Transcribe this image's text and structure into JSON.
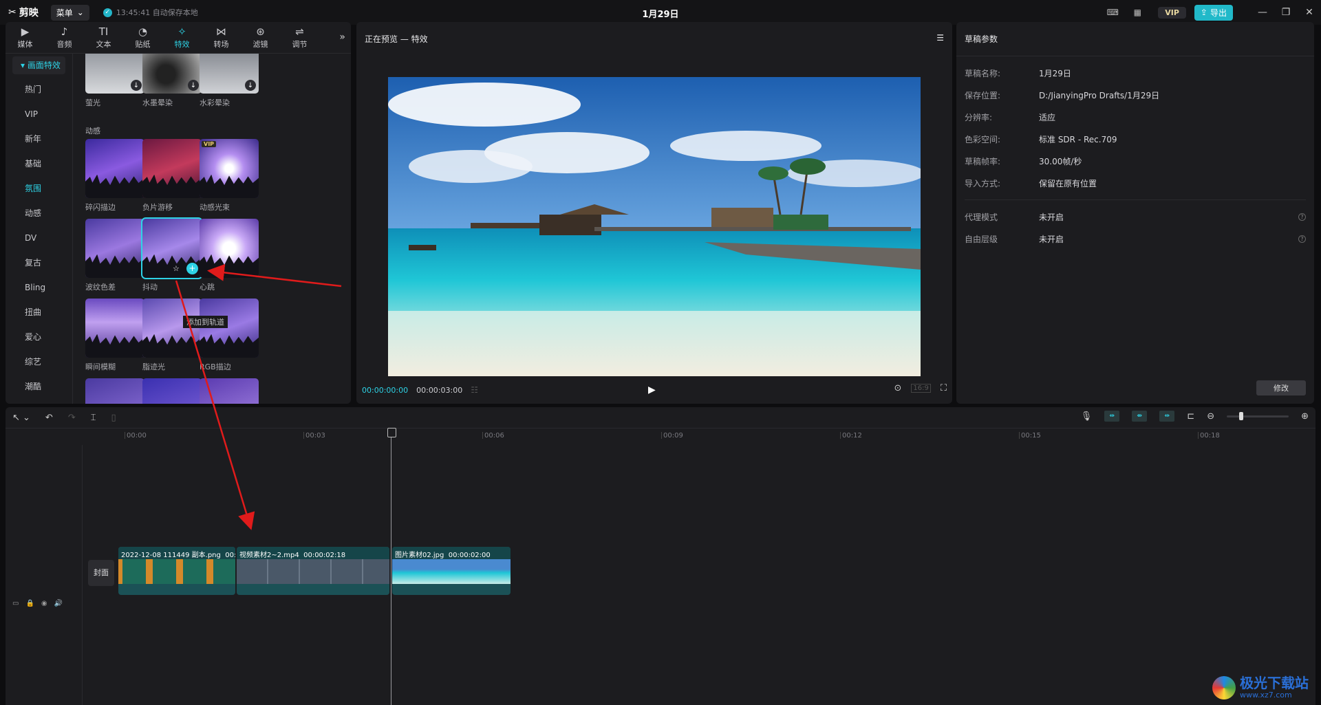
{
  "app": {
    "name": "剪映",
    "menu": "菜单",
    "autosave": "13:45:41 自动保存本地",
    "doc_title": "1月29日",
    "vip": "VIP",
    "export": "导出"
  },
  "tabs": [
    {
      "label": "媒体",
      "icon": "▶"
    },
    {
      "label": "音频",
      "icon": "♪"
    },
    {
      "label": "文本",
      "icon": "TI"
    },
    {
      "label": "贴纸",
      "icon": "◔"
    },
    {
      "label": "特效",
      "icon": "✧"
    },
    {
      "label": "转场",
      "icon": "⋈"
    },
    {
      "label": "滤镜",
      "icon": "⊛"
    },
    {
      "label": "调节",
      "icon": "⇌"
    }
  ],
  "sidebar": {
    "header": "画面特效",
    "items": [
      "热门",
      "VIP",
      "新年",
      "基础",
      "氛围",
      "动感",
      "DV",
      "复古",
      "Bling",
      "扭曲",
      "爱心",
      "综艺",
      "潮酷"
    ],
    "active": "氛围"
  },
  "effects": {
    "row0": [
      "萤光",
      "水墨晕染",
      "水彩晕染"
    ],
    "section": "动感",
    "row1": [
      "碎闪描边",
      "负片游移",
      "动感光束"
    ],
    "row2": [
      "波纹色差",
      "抖动",
      "心跳"
    ],
    "row3": [
      "瞬间模糊",
      "脂迹光",
      "RGB描边"
    ],
    "vip_tag": "VIP",
    "tooltip": "添加到轨道"
  },
  "preview": {
    "title": "正在预览 — 特效",
    "time_current": "00:00:00:00",
    "time_total": "00:00:03:00",
    "ratio": "16:9"
  },
  "props": {
    "title": "草稿参数",
    "rows": [
      {
        "key": "草稿名称:",
        "val": "1月29日"
      },
      {
        "key": "保存位置:",
        "val": "D:/JianyingPro Drafts/1月29日"
      },
      {
        "key": "分辨率:",
        "val": "适应"
      },
      {
        "key": "色彩空间:",
        "val": "标准 SDR - Rec.709"
      },
      {
        "key": "草稿帧率:",
        "val": "30.00帧/秒"
      },
      {
        "key": "导入方式:",
        "val": "保留在原有位置"
      }
    ],
    "rows2": [
      {
        "key": "代理模式",
        "val": "未开启"
      },
      {
        "key": "自由层级",
        "val": "未开启"
      }
    ],
    "modify": "修改"
  },
  "timeline": {
    "ticks": [
      "00:00",
      "00:03",
      "00:06",
      "00:09",
      "00:12",
      "00:15",
      "00:18"
    ],
    "cover": "封面",
    "clips": [
      {
        "name": "2022-12-08 111449 副本.png",
        "dur": "00:0"
      },
      {
        "name": "视频素材2~2.mp4",
        "dur": "00:00:02:18"
      },
      {
        "name": "图片素材02.jpg",
        "dur": "00:00:02:00"
      }
    ]
  },
  "watermark": {
    "name": "极光下载站",
    "url": "www.xz7.com"
  },
  "colors": {
    "accent": "#2ed3e6",
    "arrow": "#e01b1b"
  }
}
